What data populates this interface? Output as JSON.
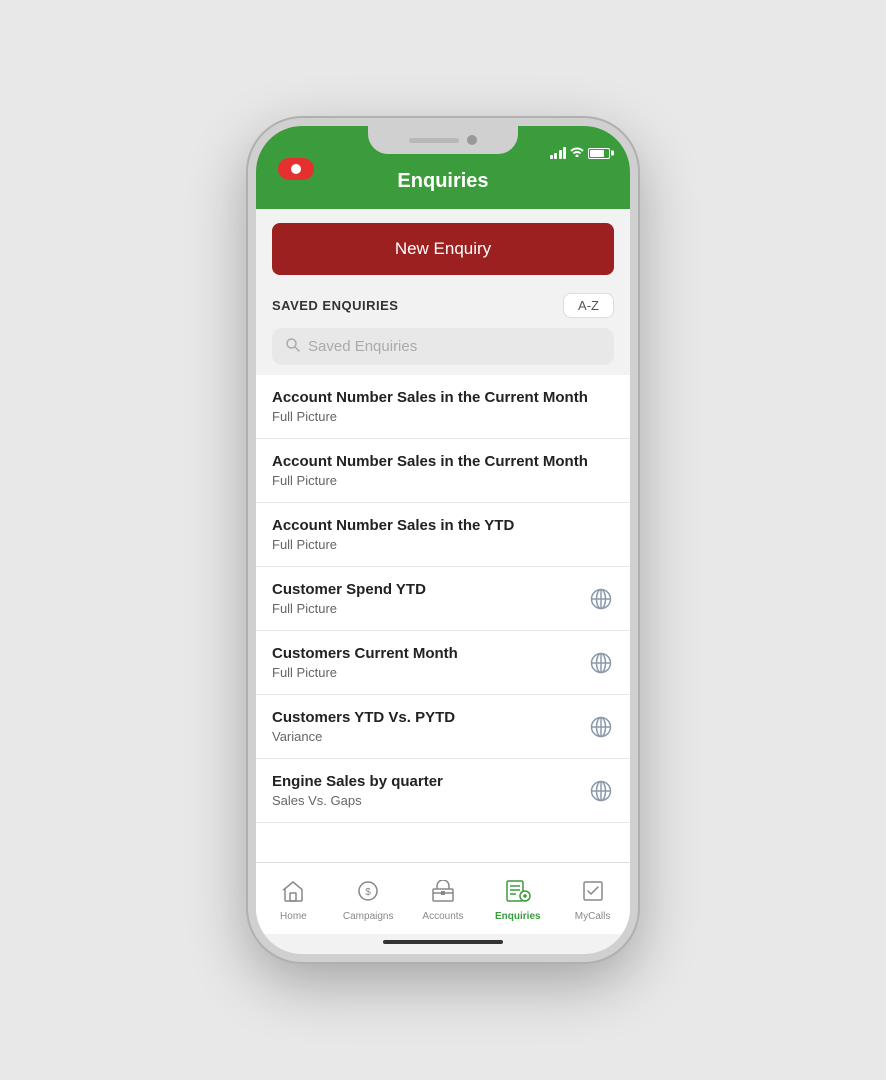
{
  "header": {
    "title": "Enquiries"
  },
  "new_enquiry_button": {
    "label": "New Enquiry"
  },
  "saved_enquiries": {
    "section_label": "SAVED ENQUIRIES",
    "sort_label": "A-Z",
    "search_placeholder": "Saved Enquiries"
  },
  "enquiry_items": [
    {
      "title": "Account Number Sales in the Current Month",
      "subtitle": "Full Picture",
      "has_globe": false
    },
    {
      "title": "Account Number Sales in the Current Month",
      "subtitle": "Full Picture",
      "has_globe": false
    },
    {
      "title": "Account Number Sales in the YTD",
      "subtitle": "Full Picture",
      "has_globe": false
    },
    {
      "title": "Customer Spend YTD",
      "subtitle": "Full Picture",
      "has_globe": true
    },
    {
      "title": "Customers Current Month",
      "subtitle": "Full Picture",
      "has_globe": true
    },
    {
      "title": "Customers YTD Vs. PYTD",
      "subtitle": "Variance",
      "has_globe": true
    },
    {
      "title": "Engine Sales by quarter",
      "subtitle": "Sales Vs. Gaps",
      "has_globe": true
    }
  ],
  "tab_bar": {
    "items": [
      {
        "label": "Home",
        "icon": "🏠",
        "active": false
      },
      {
        "label": "Campaigns",
        "icon": "💰",
        "active": false
      },
      {
        "label": "Accounts",
        "icon": "🏛",
        "active": false
      },
      {
        "label": "Enquiries",
        "icon": "🔍",
        "active": true
      },
      {
        "label": "MyCalls",
        "icon": "✔",
        "active": false
      }
    ]
  },
  "colors": {
    "green": "#3a9c3a",
    "red_button": "#9c2020",
    "active_tab": "#3a9c3a"
  }
}
